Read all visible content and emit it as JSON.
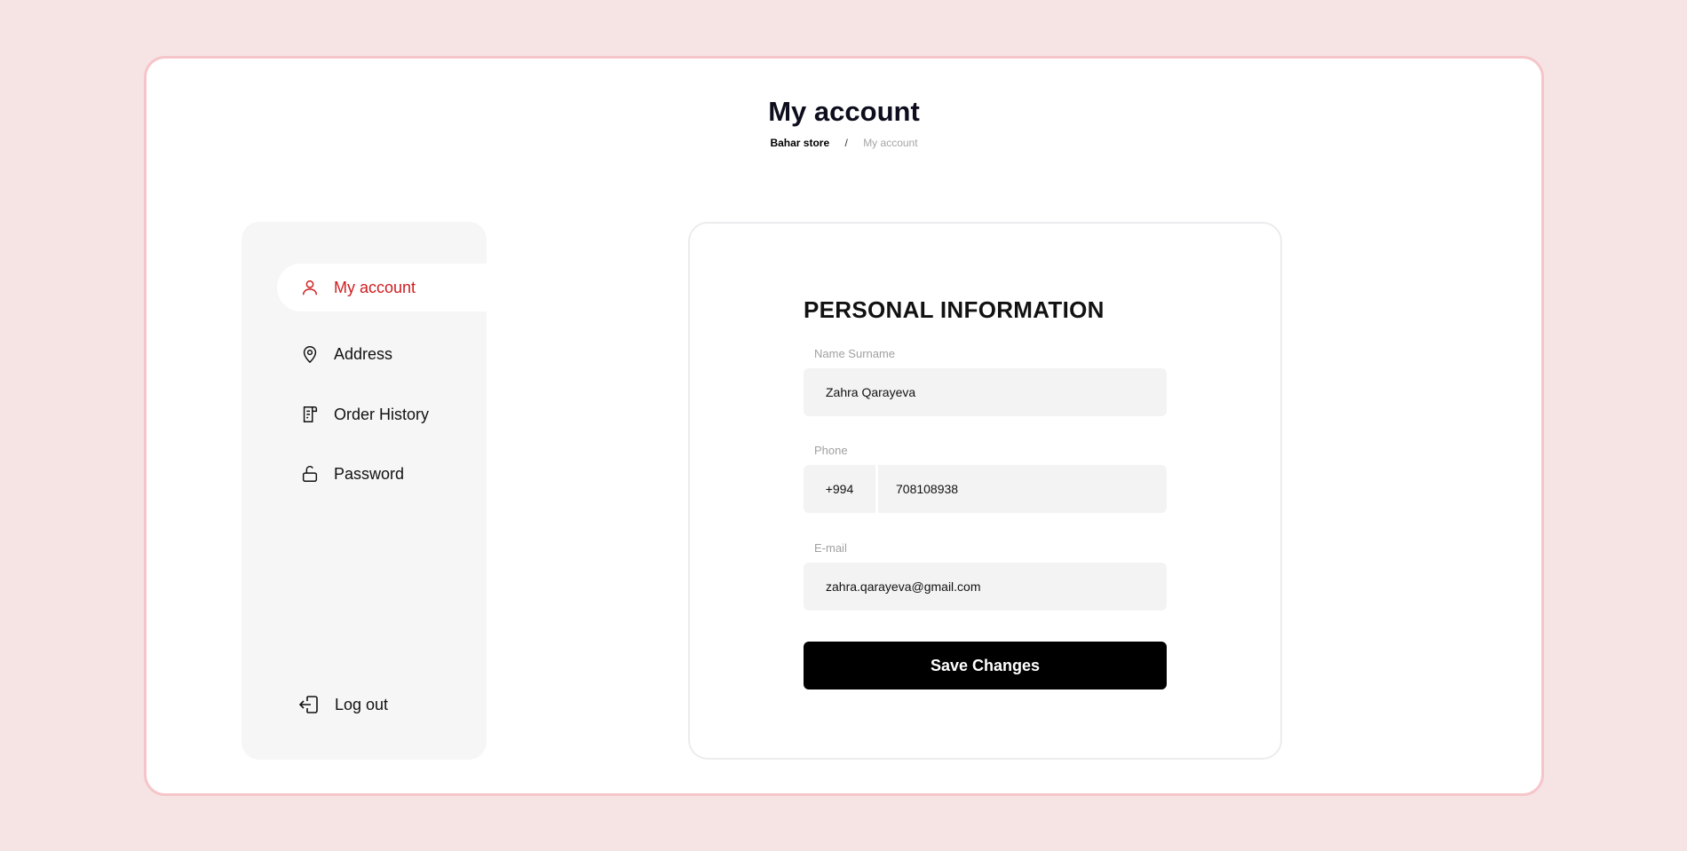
{
  "header": {
    "title": "My account",
    "breadcrumb": {
      "home": "Bahar store",
      "separator": "/",
      "current": "My account"
    }
  },
  "sidebar": {
    "items": [
      {
        "label": "My account",
        "icon": "user-icon",
        "active": true
      },
      {
        "label": "Address",
        "icon": "map-pin-icon",
        "active": false
      },
      {
        "label": "Order History",
        "icon": "receipt-icon",
        "active": false
      },
      {
        "label": "Password",
        "icon": "lock-icon",
        "active": false
      }
    ],
    "logout": {
      "label": "Log out",
      "icon": "logout-icon"
    }
  },
  "form": {
    "title": "PERSONAL INFORMATION",
    "name": {
      "label": "Name Surname",
      "value": "Zahra Qarayeva"
    },
    "phone": {
      "label": "Phone",
      "code": "+994",
      "value": "708108938"
    },
    "email": {
      "label": "E-mail",
      "value": "zahra.qarayeva@gmail.com"
    },
    "save_label": "Save Changes"
  },
  "colors": {
    "background": "#f6e4e5",
    "frame_border": "#f6c5c9",
    "accent": "#d01c1f",
    "button": "#000000"
  }
}
